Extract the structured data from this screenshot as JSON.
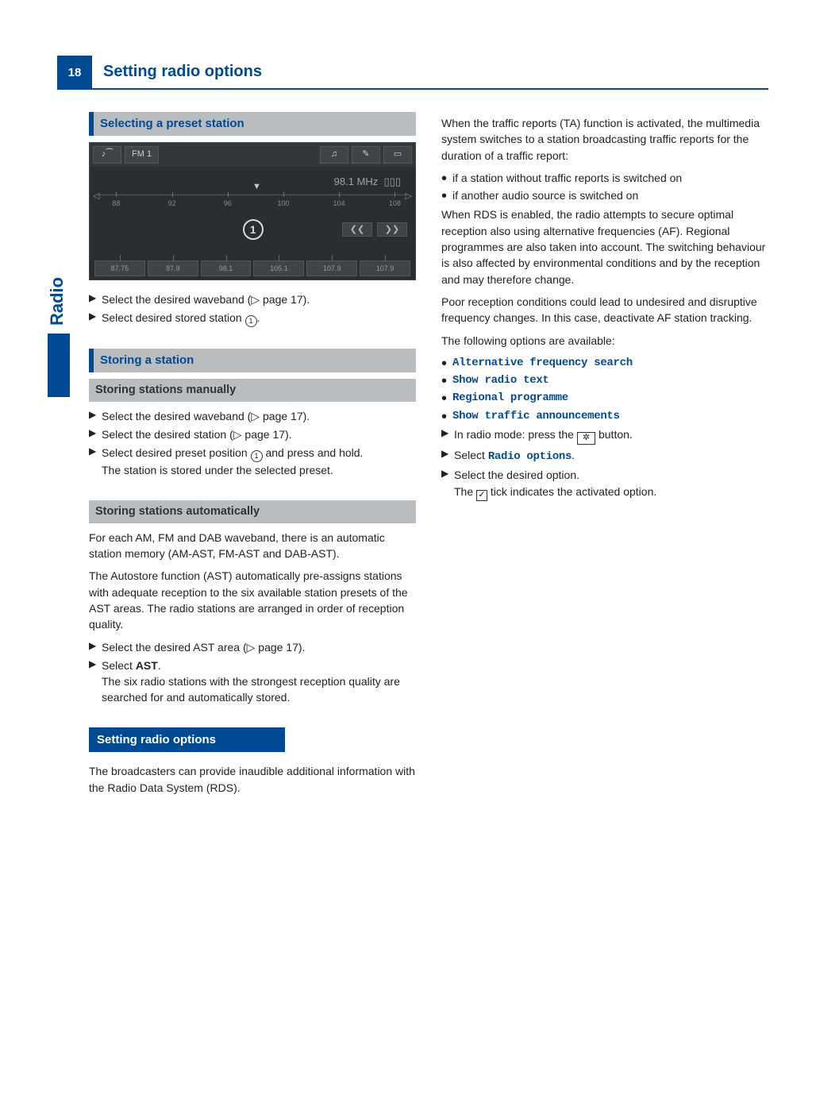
{
  "page": {
    "number": "18",
    "title": "Setting radio options",
    "side_tab": "Radio"
  },
  "screenshot": {
    "band_label": "FM 1",
    "freq_display": "98.1  MHz",
    "scale_labels": [
      "88",
      "92",
      "96",
      "100",
      "104",
      "108"
    ],
    "marker_label": "1",
    "presets": [
      "87.75",
      "87.9",
      "98.1",
      "105.1",
      "107.9",
      "107.9"
    ],
    "prev_glyph": "❮❮",
    "next_glyph": "❯❯"
  },
  "left": {
    "h2_selecting": "Selecting a preset station",
    "step_select_waveband": "Select the desired waveband (▷ page 17).",
    "step_select_stored_pre": "Select desired stored station ",
    "step_select_stored_post": ".",
    "h2_storing": "Storing a station",
    "h3_manual": "Storing stations manually",
    "man_step1": "Select the desired waveband (▷ page 17).",
    "man_step2": "Select the desired station (▷ page 17).",
    "man_step3_pre": "Select desired preset position ",
    "man_step3_post": " and press and hold.",
    "man_step3_result": "The station is stored under the selected preset.",
    "h3_auto": "Storing stations automatically",
    "auto_p1": "For each AM, FM and DAB waveband, there is an automatic station memory (AM-AST, FM-AST and DAB-AST).",
    "auto_p2": "The Autostore function (AST) automatically pre-assigns stations with adequate reception to the six available station presets of the AST areas. The radio stations are arranged in order of reception quality.",
    "auto_step1": "Select the desired AST area (▷ page 17).",
    "auto_step2_pre": "Select ",
    "auto_step2_bold": "AST",
    "auto_step2_post": ".",
    "auto_step2_result": "The six radio stations with the strongest reception quality are searched for and automatically stored.",
    "h1_setting": "Setting radio options",
    "setting_p1": "The broadcasters can provide inaudible additional information with the Radio Data System (RDS)."
  },
  "right": {
    "p1": "When the traffic reports (TA) function is activated, the multimedia system switches to a station broadcasting traffic reports for the duration of a traffic report:",
    "b1": "if a station without traffic reports is switched on",
    "b2": "if another audio source is switched on",
    "p2": "When RDS is enabled, the radio attempts to secure optimal reception also using alternative frequencies (AF). Regional programmes are also taken into account. The switching behaviour is also affected by environmental conditions and by the reception and may therefore change.",
    "p3": "Poor reception conditions could lead to undesired and disruptive frequency changes. In this case, deactivate AF station tracking.",
    "p4": "The following options are available:",
    "opt1": "Alternative frequency search",
    "opt2": "Show radio text",
    "opt3": "Regional programme",
    "opt4": "Show traffic announcements",
    "step_radio_mode_pre": "In radio mode: press the ",
    "step_radio_mode_post": " button.",
    "gear_glyph": "✲",
    "step_select_pre": "Select ",
    "step_select_mono": "Radio options",
    "step_select_post": ".",
    "step_desired": "Select the desired option.",
    "step_tick_pre": "The ",
    "step_tick_post": " tick indicates the activated option.",
    "tick_glyph": "✓"
  }
}
